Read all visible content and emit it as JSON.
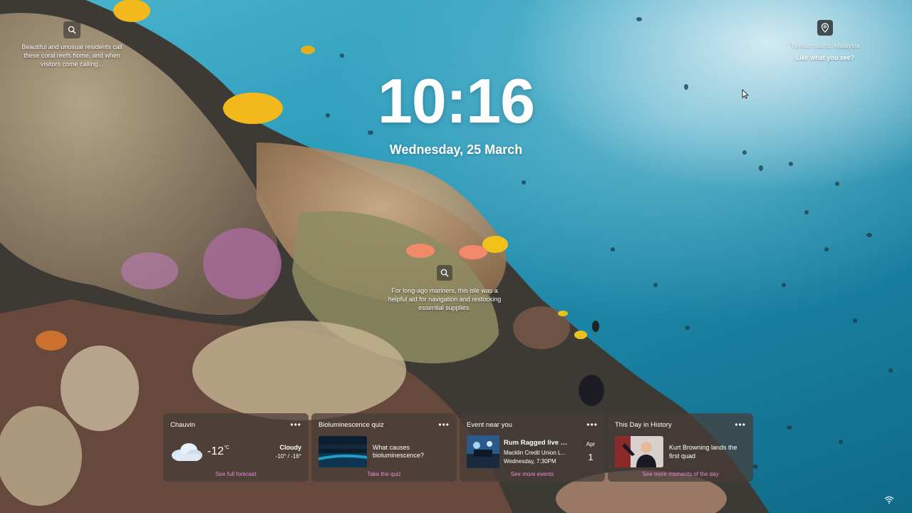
{
  "wallpaper": {
    "top_left_caption": "Beautiful and unusual residents call these coral reefs home, and when visitors come calling...",
    "center_caption": "For long-ago mariners, this isle was a helpful aid for navigation and restocking essential supplies.",
    "location_name": "Tioman Island, Malaysia",
    "location_prompt": "Like what you see?"
  },
  "clock": {
    "time": "10:16",
    "date": "Wednesday, 25 March"
  },
  "widgets": {
    "weather": {
      "title": "Chauvin",
      "temperature": "-12",
      "unit": "°C",
      "condition": "Cloudy",
      "range": "-10° / -16°",
      "link": "See full forecast",
      "icon": "cloud-icon"
    },
    "quiz": {
      "title": "Bioluminescence quiz",
      "question": "What causes bioluminescence?",
      "link": "Take the quiz"
    },
    "event": {
      "title": "Event near you",
      "event_name": "Rum Ragged live a...",
      "venue": "Macklin Credit Union L...",
      "time": "Wednesday, 7:30PM",
      "month": "Apr",
      "day": "1",
      "link": "See more events"
    },
    "history": {
      "title": "This Day in History",
      "headline": "Kurt Browning lands the first quad",
      "link": "See more moments of the day"
    },
    "more_label": "•••"
  },
  "colors": {
    "link": "#e98bd8",
    "widget_bg": "rgba(70,60,55,0.72)"
  }
}
